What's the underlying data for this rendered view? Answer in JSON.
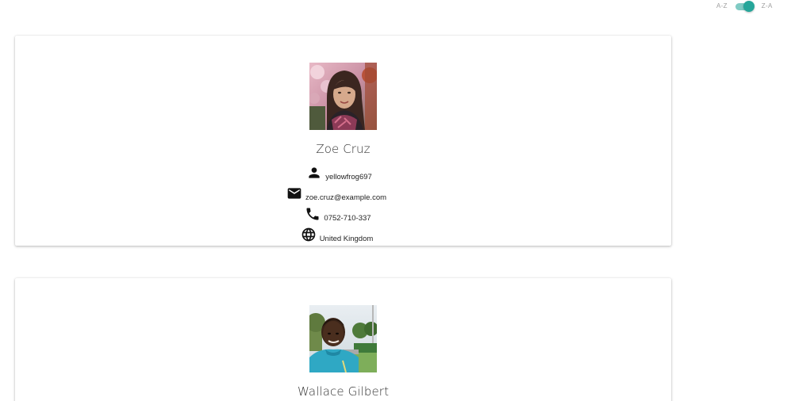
{
  "sort": {
    "left_label": "A-Z",
    "right_label": "Z-A",
    "selected": "Z-A",
    "accent_color": "#26a69a"
  },
  "users": [
    {
      "name": "Zoe Cruz",
      "username": "yellowfrog697",
      "email": "zoe.cruz@example.com",
      "phone": "0752-710-337",
      "country": "United Kingdom",
      "icons": [
        "person-icon",
        "mail-icon",
        "phone-icon",
        "globe-icon"
      ]
    },
    {
      "name": "Wallace Gilbert"
    }
  ]
}
